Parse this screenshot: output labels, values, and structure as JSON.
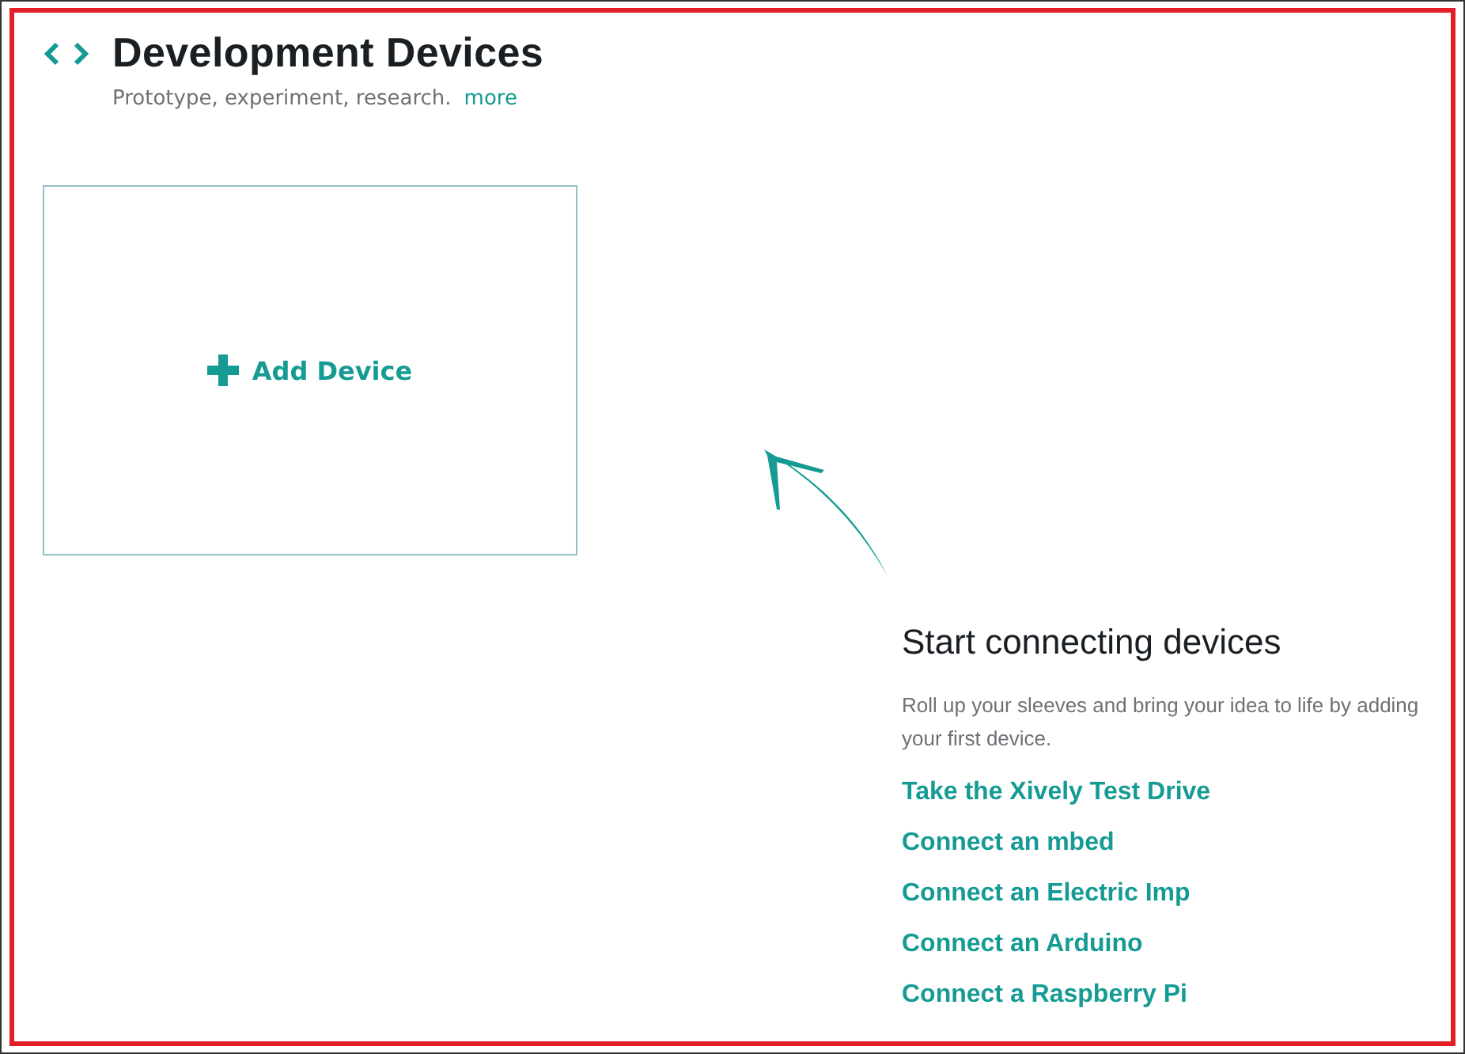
{
  "header": {
    "title": "Development Devices",
    "subtitle": "Prototype, experiment, research.",
    "more_link": "more"
  },
  "add_device": {
    "label": "Add Device"
  },
  "getting_started": {
    "heading": "Start connecting devices",
    "description": "Roll up your sleeves and bring your idea to life by adding your first device.",
    "links": [
      "Take the Xively Test Drive",
      "Connect an mbed",
      "Connect an Electric Imp",
      "Connect an Arduino",
      "Connect a Raspberry Pi"
    ]
  }
}
